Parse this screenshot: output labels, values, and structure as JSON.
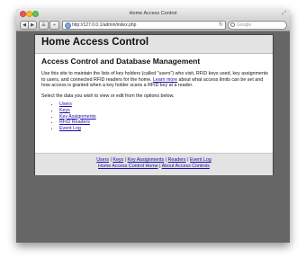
{
  "window": {
    "title": "Home Access Control"
  },
  "toolbar": {
    "back_icon": "◀",
    "forward_icon": "▶",
    "reader_icon": "☰",
    "add_icon": "+",
    "url": "http://127.0.0.1/admin/index.php",
    "reload_icon": "↻",
    "search_placeholder": "Google"
  },
  "page": {
    "site_title": "Home Access Control",
    "heading": "Access Control and Database Management",
    "intro_before_link": "Use this site to maintain the lists of key holders (called \"users\") who visit, RFID keys used, key assignments to users, and connected RFID readers for the home. ",
    "intro_link": "Learn more",
    "intro_after_link": " about what access limits can be set and how access is granted when a key holder scans a RFID key at a reader.",
    "prompt": "Select the data you wish to view or edit from the options below.",
    "nav_links": [
      "Users",
      "Keys",
      "Key Assignments",
      "RFID Readers",
      "Event Log"
    ]
  },
  "footer": {
    "row1": [
      "Users",
      "Keys",
      "Key Assignments",
      "Readers",
      "Event Log"
    ],
    "row2": [
      "Home Access Control Home",
      "About Access Controls"
    ],
    "separator": "|"
  },
  "colors": {
    "link": "#1a0dab",
    "band": "#e3e3e3",
    "backdrop": "#666666"
  }
}
